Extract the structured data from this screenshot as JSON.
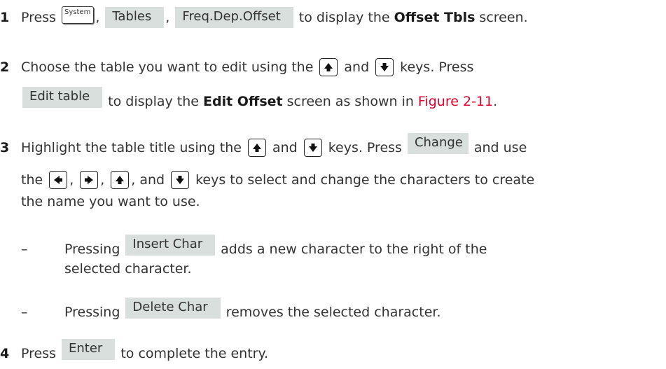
{
  "step1": {
    "number": "1",
    "press": "Press",
    "system_key": "System",
    "sep": ",",
    "tables_key": "Tables",
    "freq_key": "Freq.Dep.Offset",
    "to_display": "to display the",
    "screen_name": "Offset Tbls",
    "end": "screen."
  },
  "step2": {
    "number": "2",
    "text_a": "Choose the table you want to edit using the",
    "and": "and",
    "keys_press": "keys. Press",
    "edit_key": "Edit table",
    "to_display": "to display the",
    "screen_name": "Edit Offset",
    "shown_in": "screen as shown in",
    "figure_ref": "Figure 2-11",
    "period": "."
  },
  "step3": {
    "number": "3",
    "text_a": "Highlight the table title using the",
    "and": "and",
    "keys_press": "keys. Press",
    "change_key": "Change",
    "and_use": "and use",
    "the": "the",
    "and2": "and",
    "text_b": "keys to select and change the characters to create",
    "text_c": "the name you want to use."
  },
  "bullets": [
    {
      "dash": "–",
      "pressing": "Pressing",
      "key": "Insert Char",
      "text": "adds a new character to the right of the",
      "text2": "selected character."
    },
    {
      "dash": "–",
      "pressing": "Pressing",
      "key": "Delete Char",
      "text": "removes the selected character."
    }
  ],
  "step4": {
    "number": "4",
    "press": "Press",
    "enter_key": "Enter",
    "text": "to complete the entry."
  },
  "icons": {
    "up": "up-arrow-key-icon",
    "down": "down-arrow-key-icon",
    "left": "left-arrow-key-icon",
    "right": "right-arrow-key-icon"
  }
}
